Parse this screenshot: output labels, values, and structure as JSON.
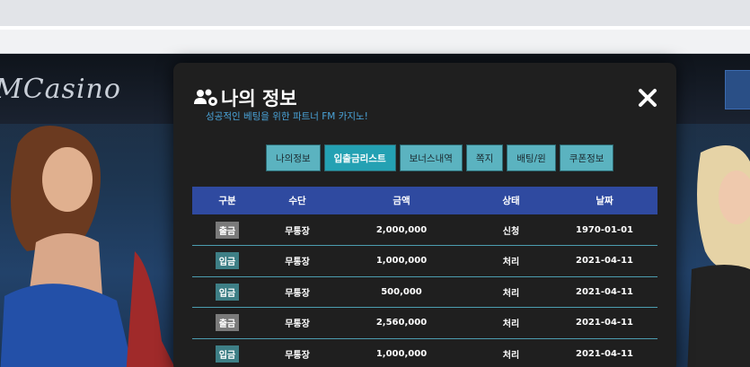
{
  "site": {
    "logo_text": "MCasino"
  },
  "modal": {
    "title": "나의 정보",
    "subtitle": "성공적인 베팅을 위한 파트너 FM 카지노!",
    "title_icon": "users-gear-icon",
    "close_icon": "close-icon"
  },
  "tabs": [
    {
      "label": "나의정보",
      "active": false
    },
    {
      "label": "입출금리스트",
      "active": true
    },
    {
      "label": "보너스내역",
      "active": false
    },
    {
      "label": "쪽지",
      "active": false
    },
    {
      "label": "배팅/윈",
      "active": false
    },
    {
      "label": "쿠폰정보",
      "active": false
    }
  ],
  "table": {
    "headers": [
      "구분",
      "수단",
      "금액",
      "상태",
      "날짜"
    ],
    "rows": [
      {
        "type": "출금",
        "method": "무통장",
        "amount": "2,000,000",
        "status": "신청",
        "date": "1970-01-01"
      },
      {
        "type": "입금",
        "method": "무통장",
        "amount": "1,000,000",
        "status": "처리",
        "date": "2021-04-11"
      },
      {
        "type": "입금",
        "method": "무통장",
        "amount": "500,000",
        "status": "처리",
        "date": "2021-04-11"
      },
      {
        "type": "출금",
        "method": "무통장",
        "amount": "2,560,000",
        "status": "처리",
        "date": "2021-04-11"
      },
      {
        "type": "입금",
        "method": "무통장",
        "amount": "1,000,000",
        "status": "처리",
        "date": "2021-04-11"
      }
    ]
  },
  "colors": {
    "accent": "#24a1b3",
    "table_header": "#2f4aa0",
    "subtitle": "#4aa3d8"
  }
}
